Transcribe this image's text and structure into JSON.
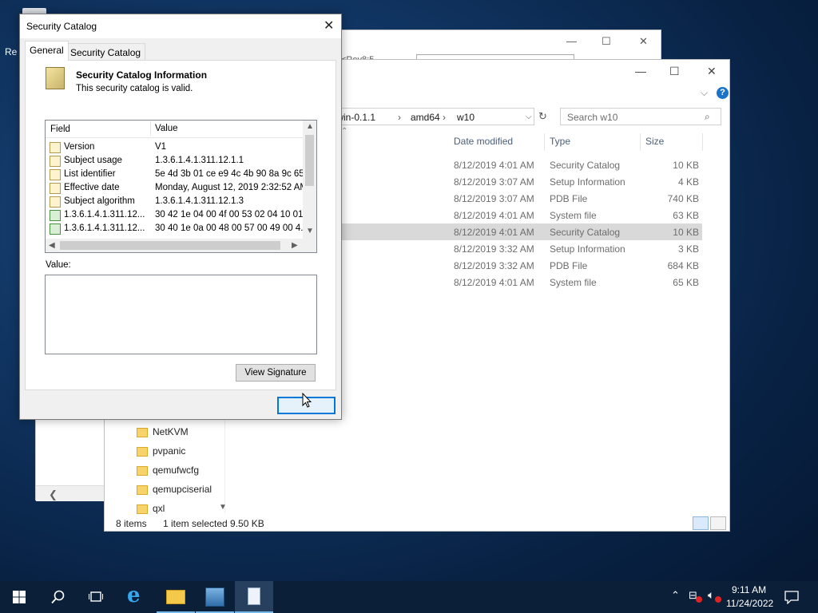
{
  "desktop": {
    "icon_label": "Re"
  },
  "back_window": {
    "address_fragment": "<Rev8:5",
    "min": "—",
    "max": "☐",
    "close": "✕"
  },
  "explorer": {
    "min": "—",
    "max": "☐",
    "close": "✕",
    "help": "?",
    "breadcrumb": [
      "io-win-0.1.1",
      "amd64",
      "w10"
    ],
    "search_placeholder": "Search w10",
    "columns": {
      "date": "Date modified",
      "type": "Type",
      "size": "Size"
    },
    "rows": [
      {
        "date": "8/12/2019 4:01 AM",
        "type": "Security Catalog",
        "size": "10 KB"
      },
      {
        "date": "8/12/2019 3:07 AM",
        "type": "Setup Information",
        "size": "4 KB"
      },
      {
        "date": "8/12/2019 3:07 AM",
        "type": "PDB File",
        "size": "740 KB"
      },
      {
        "date": "8/12/2019 4:01 AM",
        "type": "System file",
        "size": "63 KB"
      },
      {
        "date": "8/12/2019 4:01 AM",
        "type": "Security Catalog",
        "size": "10 KB"
      },
      {
        "date": "8/12/2019 3:32 AM",
        "type": "Setup Information",
        "size": "3 KB"
      },
      {
        "date": "8/12/2019 3:32 AM",
        "type": "PDB File",
        "size": "684 KB"
      },
      {
        "date": "8/12/2019 4:01 AM",
        "type": "System file",
        "size": "65 KB"
      }
    ],
    "nav_folders": [
      "NetKVM",
      "pvpanic",
      "qemufwcfg",
      "qemupciserial",
      "qxl"
    ],
    "status": {
      "items": "8 items",
      "selected": "1 item selected  9.50 KB"
    }
  },
  "dialog": {
    "title": "Security Catalog",
    "close": "✕",
    "tabs": [
      "General",
      "Security Catalog"
    ],
    "heading": "Security Catalog Information",
    "subtext": "This security catalog is valid.",
    "list_headers": {
      "field": "Field",
      "value": "Value"
    },
    "fields": [
      {
        "field": "Version",
        "value": "V1",
        "icon": "doc"
      },
      {
        "field": "Subject usage",
        "value": "1.3.6.1.4.1.311.12.1.1",
        "icon": "doc"
      },
      {
        "field": "List identifier",
        "value": "5e 4d 3b 01 ce e9 4c 4b 90 8a 9c 65...",
        "icon": "doc"
      },
      {
        "field": "Effective date",
        "value": "Monday, August 12, 2019 2:32:52 AM",
        "icon": "doc"
      },
      {
        "field": "Subject algorithm",
        "value": "1.3.6.1.4.1.311.12.1.3",
        "icon": "doc"
      },
      {
        "field": "1.3.6.1.4.1.311.12...",
        "value": "30 42 1e 04 00 4f 00 53 02 04 10 01...",
        "icon": "ext"
      },
      {
        "field": "1.3.6.1.4.1.311.12...",
        "value": "30 40 1e 0a 00 48 00 57 00 49 00 4...",
        "icon": "ext"
      }
    ],
    "value_label": "Value:",
    "view_signature": "View Signature",
    "ok": ""
  },
  "taskbar": {
    "time": "9:11 AM",
    "date": "11/24/2022",
    "icons": [
      "start-icon",
      "search-icon",
      "task-view-icon",
      "internet-explorer-icon",
      "file-explorer-icon",
      "server-manager-icon",
      "document-icon"
    ]
  }
}
